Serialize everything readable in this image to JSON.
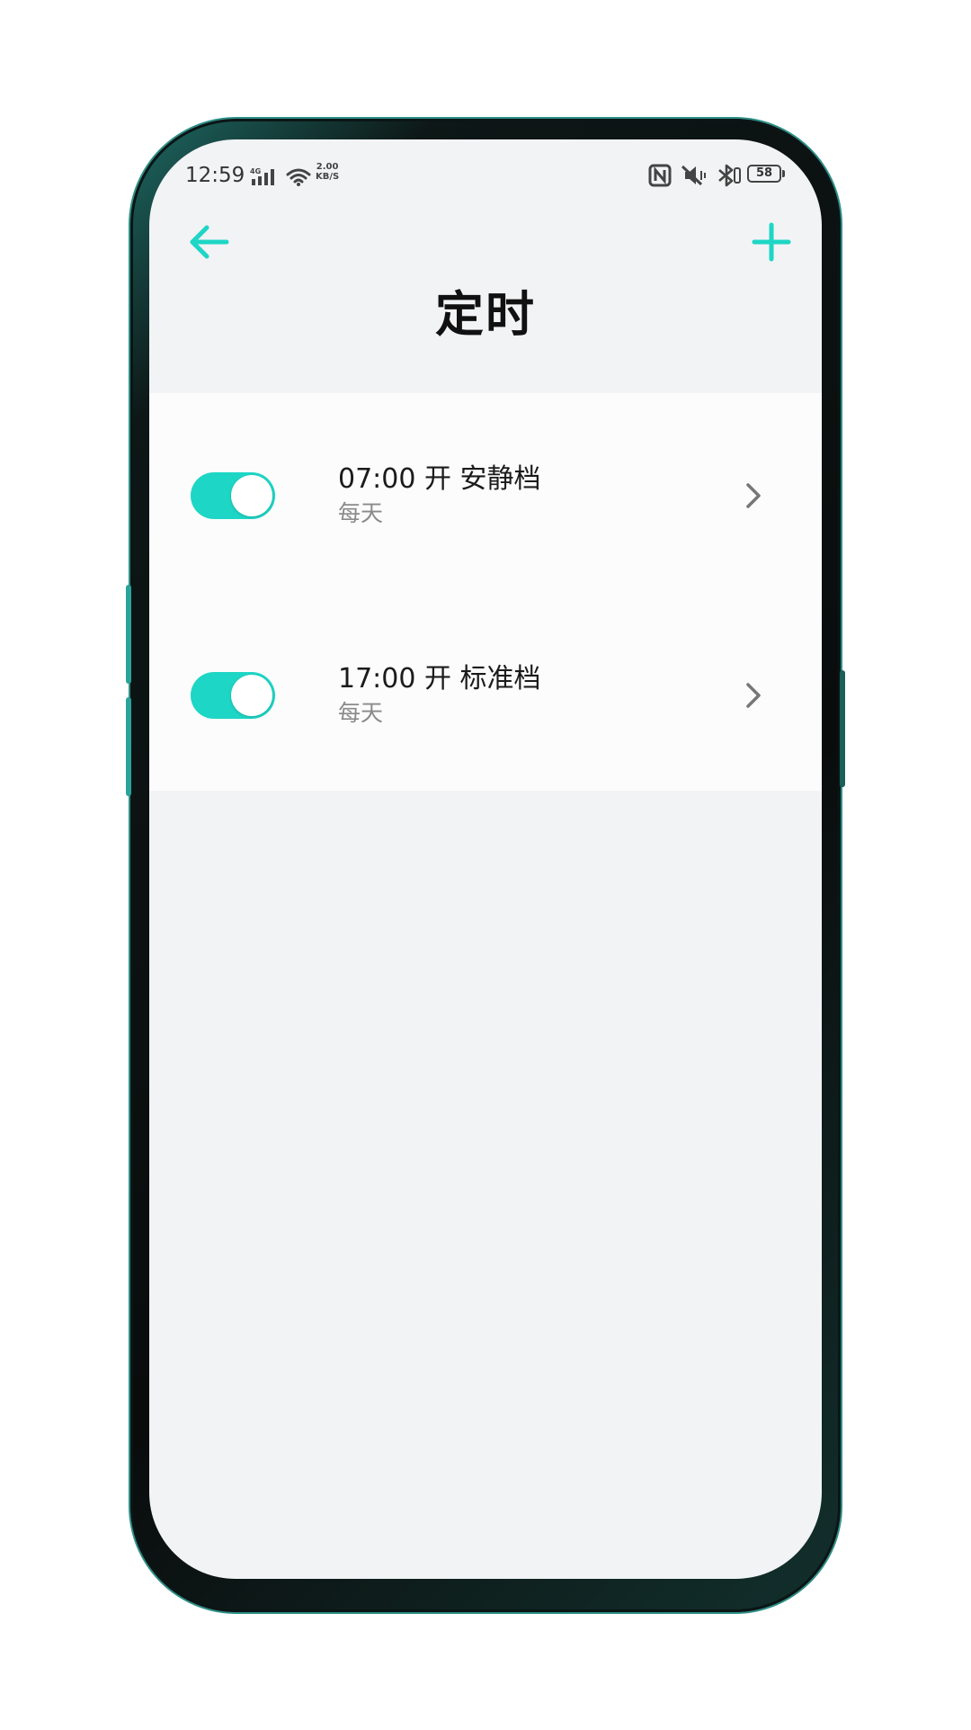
{
  "status_bar": {
    "time": "12:59",
    "network": "4G",
    "speed_value": "2.00",
    "speed_unit": "KB/S",
    "battery": "58"
  },
  "header": {
    "back_icon": "arrow-left-icon",
    "add_icon": "plus-icon",
    "title": "定时",
    "accent_color": "#1ed6c5"
  },
  "timers": [
    {
      "label": "07:00 开 安静档",
      "repeat": "每天",
      "enabled": true
    },
    {
      "label": "17:00 开 标准档",
      "repeat": "每天",
      "enabled": true
    }
  ],
  "colors": {
    "screen_bg": "#f2f3f5",
    "list_bg": "#fcfcfd",
    "toggle_on": "#1ed6c5"
  }
}
